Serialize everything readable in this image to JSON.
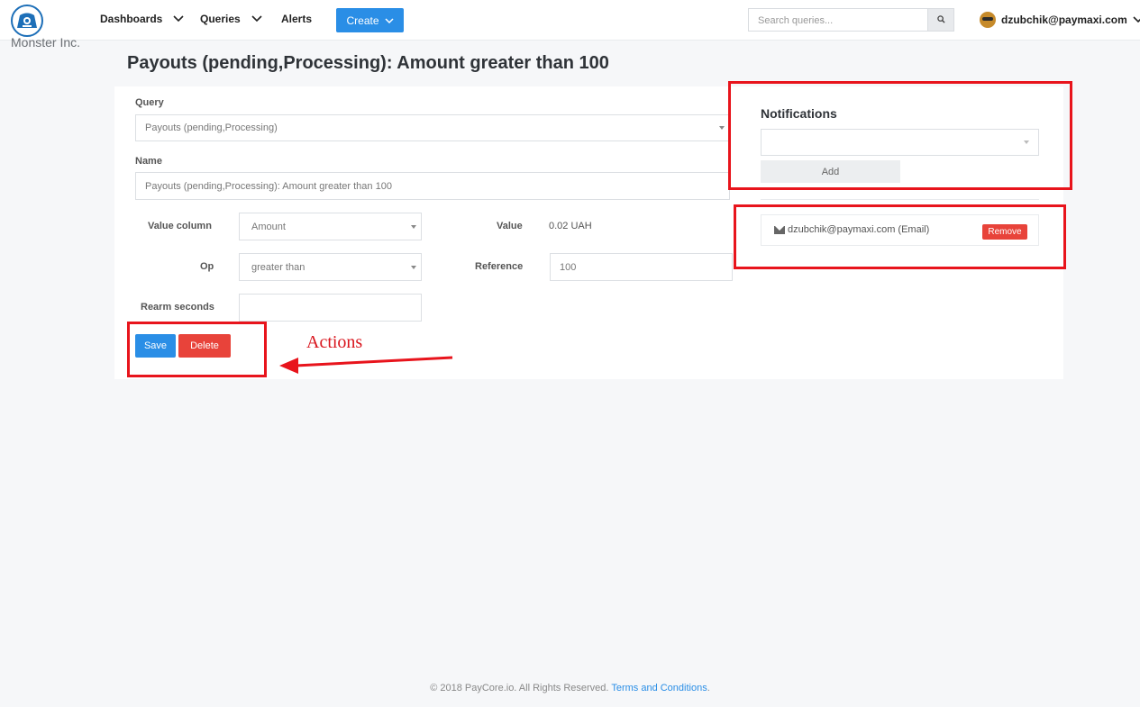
{
  "header": {
    "org_name": "Monster Inc.",
    "nav": {
      "dashboards": "Dashboards",
      "queries": "Queries",
      "alerts": "Alerts",
      "create": "Create"
    },
    "search_placeholder": "Search queries...",
    "user_email": "dzubchik@paymaxi.com"
  },
  "page": {
    "title": "Payouts (pending,Processing): Amount greater than 100"
  },
  "form": {
    "query_label": "Query",
    "query_value": "Payouts (pending,Processing)",
    "name_label": "Name",
    "name_value": "Payouts (pending,Processing): Amount greater than 100",
    "value_column_label": "Value column",
    "value_column_selected": "Amount",
    "value_label": "Value",
    "value_display": "0.02 UAH",
    "op_label": "Op",
    "op_selected": "greater than",
    "reference_label": "Reference",
    "reference_value": "100",
    "rearm_label": "Rearm seconds",
    "rearm_value": "",
    "save_label": "Save",
    "delete_label": "Delete"
  },
  "notifications": {
    "title": "Notifications",
    "add_label": "Add",
    "subscribers": [
      {
        "text": "dzubchik@paymaxi.com (Email)",
        "remove_label": "Remove"
      }
    ]
  },
  "annotation": {
    "label": "Actions",
    "color": "#e8141c"
  },
  "footer": {
    "text": "© 2018 PayCore.io. All Rights Reserved.",
    "link": "Terms and Conditions",
    "suffix": "."
  },
  "colors": {
    "primary": "#2a8ee6",
    "danger": "#e8433a",
    "background": "#f6f7f9"
  }
}
